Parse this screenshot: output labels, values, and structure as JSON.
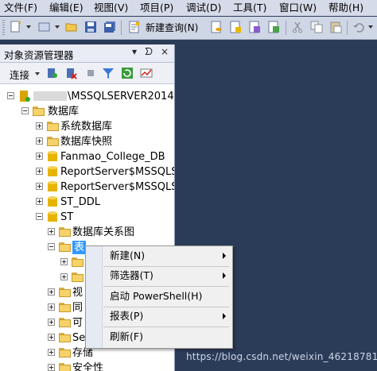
{
  "menubar": [
    "文件(F)",
    "编辑(E)",
    "视图(V)",
    "项目(P)",
    "调试(D)",
    "工具(T)",
    "窗口(W)",
    "帮助(H)"
  ],
  "toolbar": {
    "new_query": "新建查询(N)"
  },
  "explorer": {
    "title": "对象资源管理器",
    "pin": "▾ ᗤ ×",
    "connect": "连接"
  },
  "tree": {
    "server": "\\MSSQLSERVER2014",
    "databases": "数据库",
    "system_databases": "系统数据库",
    "db_snapshots": "数据库快照",
    "db1": "Fanmao_College_DB",
    "db2": "ReportServer$MSSQLS",
    "db3": "ReportServer$MSSQLS",
    "db4": "ST_DDL",
    "db5": "ST",
    "diagrams": "数据库关系图",
    "tables": "表",
    "views_partial": "视",
    "sync_partial": "同",
    "prog_partial": "可",
    "service_partial": "Se",
    "storage_partial": "存储",
    "security": "安全性"
  },
  "context_menu": {
    "new": "新建(N)",
    "filter": "筛选器(T)",
    "powershell": "启动 PowerShell(H)",
    "reports": "报表(P)",
    "refresh": "刷新(F)"
  },
  "watermark": "https://blog.csdn.net/weixin_46218781"
}
